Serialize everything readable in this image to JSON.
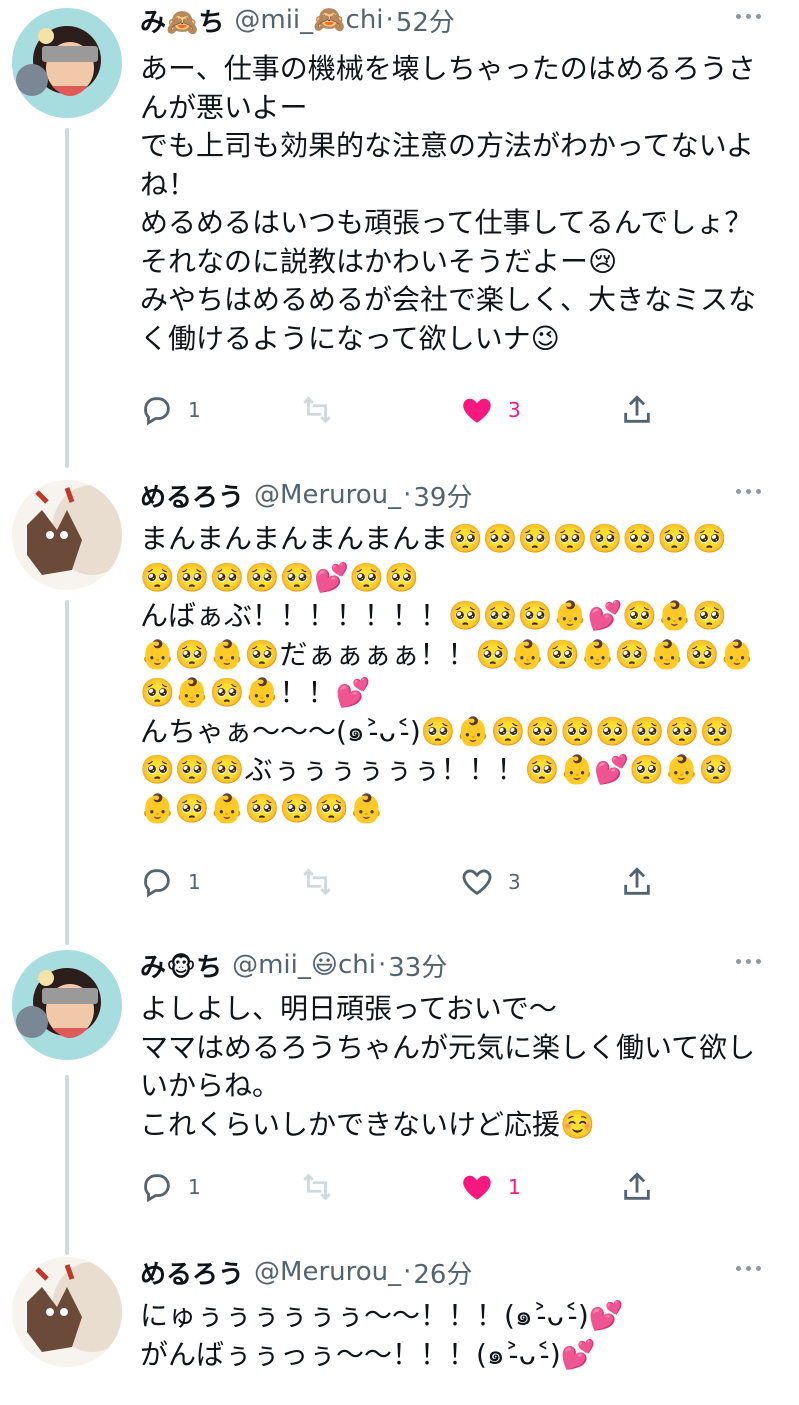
{
  "tweets": [
    {
      "name": "み🙈ち",
      "handle": "@mii_🙈chi",
      "time": "52分",
      "text": "あー、仕事の機械を壊しちゃったのはめるろうさんが悪いよー\nでも上司も効果的な注意の方法がわかってないよね！\nめるめるはいつも頑張って仕事してるんでしょ？それなのに説教はかわいそうだよー😢\nみやちはめるめるが会社で楽しく、大きなミスなく働けるようになって欲しいナ😉",
      "reply_count": "1",
      "like_count": "3",
      "liked": true
    },
    {
      "name": "めるろう",
      "handle": "@Merurou_",
      "time": "39分",
      "text": "まんまんまんまんまんま🥺🥺🥺🥺🥺🥺🥺🥺🥺🥺🥺🥺🥺💕🥺🥺\nんばぁぶ！！！！！！！🥺🥺🥺👶💕🥺👶🥺👶🥺👶🥺だぁぁぁぁ！！🥺👶🥺👶🥺👶🥺👶🥺👶🥺👶！！💕\nんちゃぁ〜〜〜(๑˃̵ᴗ˂̵)🥺👶🥺🥺🥺🥺🥺🥺🥺🥺🥺🥺ぶぅぅぅぅぅぅ！！！🥺👶💕🥺👶🥺👶🥺👶🥺🥺🥺👶",
      "reply_count": "1",
      "like_count": "3",
      "liked": false
    },
    {
      "name": "み🐵ち",
      "handle": "@mii_😃chi",
      "time": "33分",
      "text": "よしよし、明日頑張っておいで〜\nママはめるろうちゃんが元気に楽しく働いて欲しいからね。\nこれくらいしかできないけど応援☺️",
      "reply_count": "1",
      "like_count": "1",
      "liked": true
    },
    {
      "name": "めるろう",
      "handle": "@Merurou_",
      "time": "26分",
      "text": "にゅぅぅぅぅぅぅ〜〜！！！(๑˃̵ᴗ˂̵)💕\nがんばぅぅっぅ〜〜！！！(๑˃̵ᴗ˂̵)💕"
    }
  ],
  "icons": {
    "reply": "reply-icon",
    "retweet": "retweet-icon",
    "like": "heart-icon",
    "share": "share-icon",
    "more": "more-icon"
  },
  "colors": {
    "like_active": "#f91880",
    "muted": "#536471",
    "thread_line": "#cfd9de"
  }
}
